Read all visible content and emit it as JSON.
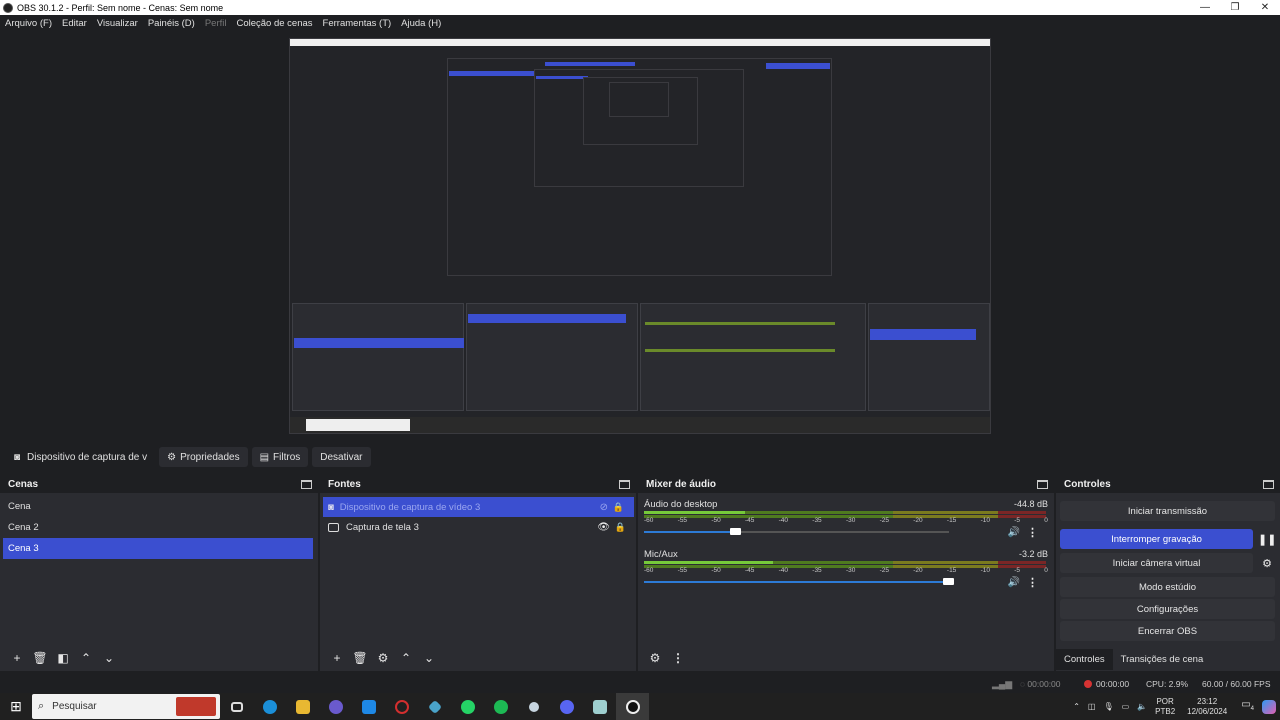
{
  "window": {
    "title": "OBS 30.1.2 - Perfil: Sem nome - Cenas: Sem nome",
    "minimize": "—",
    "restore": "❐",
    "close": "✕"
  },
  "menu": [
    "Arquivo (F)",
    "Editar",
    "Visualizar",
    "Painéis (D)",
    "Perfil",
    "Coleção de cenas",
    "Ferramentas (T)",
    "Ajuda (H)"
  ],
  "menu_disabled": "Perfil",
  "source_toolbar": {
    "source_name": "Dispositivo de captura de v",
    "properties": "Propriedades",
    "filters": "Filtros",
    "deactivate": "Desativar"
  },
  "scenes": {
    "title": "Cenas",
    "items": [
      "Cena",
      "Cena 2",
      "Cena 3"
    ],
    "selected": "Cena 3"
  },
  "sources": {
    "title": "Fontes",
    "items": [
      {
        "name": "Dispositivo de captura de vídeo 3",
        "selected": true,
        "visible": false
      },
      {
        "name": "Captura de tela 3",
        "selected": false,
        "visible": true
      }
    ]
  },
  "mixer": {
    "title": "Mixer de áudio",
    "scale": [
      "-60",
      "-55",
      "-50",
      "-45",
      "-40",
      "-35",
      "-30",
      "-25",
      "-20",
      "-15",
      "-10",
      "-5",
      "0"
    ],
    "tracks": [
      {
        "name": "Áudio do desktop",
        "db": "-44.8 dB",
        "level": 0.25,
        "volume": 0.3
      },
      {
        "name": "Mic/Aux",
        "db": "-3.2 dB",
        "level": 0.32,
        "volume": 1.0
      }
    ]
  },
  "controls": {
    "title": "Controles",
    "start_stream": "Iniciar transmissão",
    "stop_recording": "Interromper gravação",
    "start_virtualcam": "Iniciar câmera virtual",
    "studio_mode": "Modo estúdio",
    "settings": "Configurações",
    "exit": "Encerrar OBS",
    "tab_controls": "Controles",
    "tab_transitions": "Transições de cena"
  },
  "status": {
    "stream_time": "00:00:00",
    "rec_time": "00:00:00",
    "cpu": "CPU: 2.9%",
    "fps": "60.00 / 60.00 FPS"
  },
  "taskbar": {
    "search_placeholder": "Pesquisar",
    "lang_top": "POR",
    "lang_bottom": "PTB2",
    "time": "23:12",
    "date": "12/06/2024",
    "notification_count": "4"
  },
  "colors": {
    "accent": "#3b4fd0",
    "panel": "#2b2c31",
    "background": "#1e1f22",
    "recording": "#d63333"
  }
}
